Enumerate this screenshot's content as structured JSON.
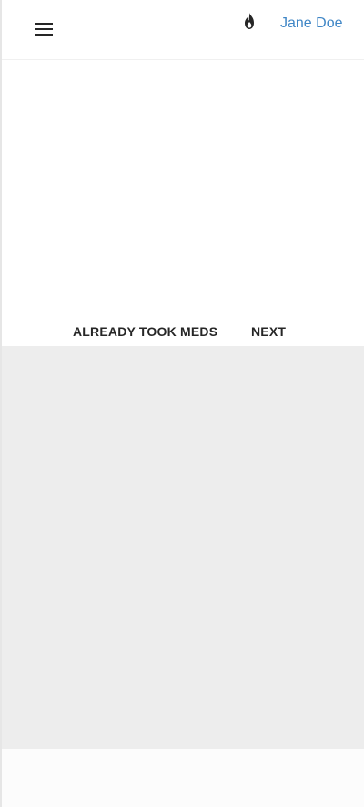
{
  "header": {
    "menu_icon": "hamburger-menu-icon",
    "flame_icon": "flame-icon",
    "user_name": "Jane Doe"
  },
  "actions": {
    "already_took_label": "ALREADY TOOK MEDS",
    "next_label": "NEXT"
  },
  "colors": {
    "link": "#3f86c6",
    "panel": "#ededed",
    "text": "#262626"
  }
}
